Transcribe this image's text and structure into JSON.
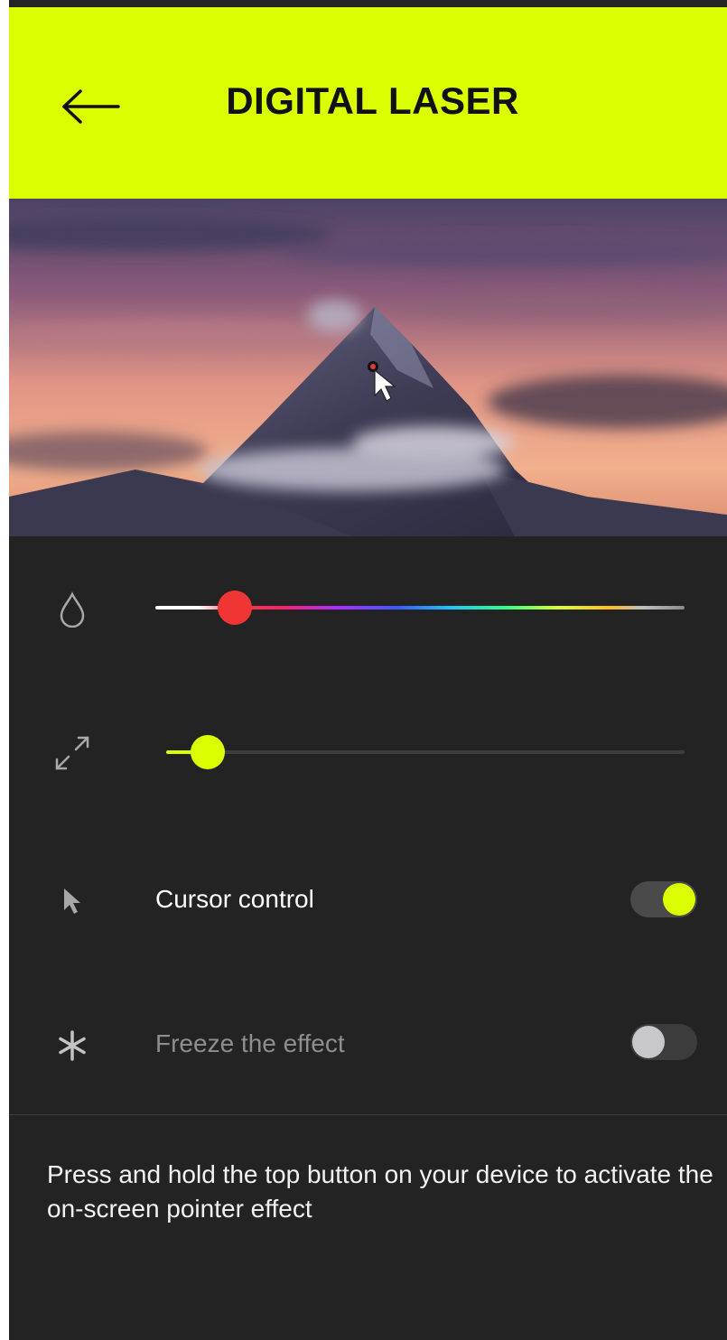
{
  "header": {
    "title": "DIGITAL LASER",
    "back_icon": "back-arrow-icon",
    "background_color": "#dcff00"
  },
  "hero": {
    "description_icon": "mountain-photo",
    "pointer_icon": "pointer-arrow-icon"
  },
  "settings": {
    "color_slider": {
      "icon": "droplet-icon",
      "value_fraction": 0.15,
      "thumb_color": "#f03535"
    },
    "size_slider": {
      "icon": "expand-icon",
      "value_fraction": 0.08,
      "thumb_color": "#dcff00"
    },
    "cursor_control": {
      "icon": "cursor-icon",
      "label": "Cursor control",
      "enabled": true
    },
    "freeze_effect": {
      "icon": "asterisk-icon",
      "label": "Freeze the effect",
      "enabled": false
    }
  },
  "hint": {
    "text": "Press and hold the top button on your device to activate the on-screen pointer effect"
  }
}
